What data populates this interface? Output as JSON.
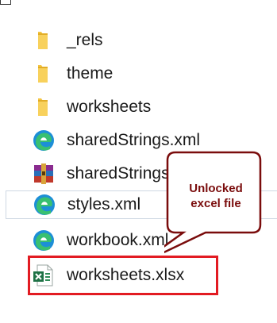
{
  "files": [
    {
      "name": "_rels",
      "icon": "folder-icon"
    },
    {
      "name": "theme",
      "icon": "folder-icon"
    },
    {
      "name": "worksheets",
      "icon": "folder-icon"
    },
    {
      "name": "sharedStrings.xml",
      "icon": "edge-icon"
    },
    {
      "name": "sharedStrings.rar",
      "icon": "winrar-icon"
    },
    {
      "name": "styles.xml",
      "icon": "edge-icon"
    },
    {
      "name": "workbook.xml",
      "icon": "edge-icon"
    },
    {
      "name": "worksheets.xlsx",
      "icon": "excel-icon"
    }
  ],
  "callout": {
    "line1": "Unlocked",
    "line2": "excel file"
  },
  "colors": {
    "folder": "#f4c542",
    "highlight": "#e21b22",
    "callout_border": "#7a0c0c",
    "callout_text": "#7a0c0c",
    "selection_border": "#cfd8e3"
  }
}
